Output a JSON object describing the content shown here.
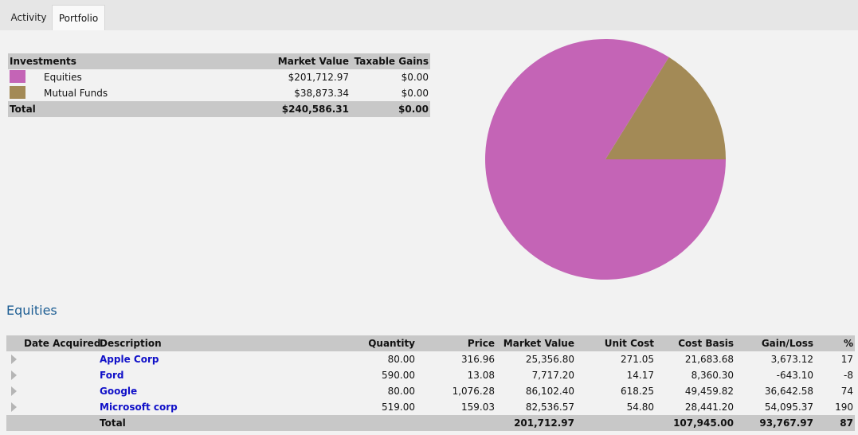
{
  "tabs": [
    {
      "label": "Activity"
    },
    {
      "label": "Portfolio"
    }
  ],
  "summary": {
    "headers": {
      "investments": "Investments",
      "market_value": "Market Value",
      "taxable_gains": "Taxable Gains"
    },
    "rows": [
      {
        "name": "Equities",
        "market_value": "$201,712.97",
        "taxable_gains": "$0.00",
        "color": "#c464b6"
      },
      {
        "name": "Mutual Funds",
        "market_value": "$38,873.34",
        "taxable_gains": "$0.00",
        "color": "#a38a56"
      }
    ],
    "total": {
      "label": "Total",
      "market_value": "$240,586.31",
      "taxable_gains": "$0.00"
    }
  },
  "chart_data": {
    "type": "pie",
    "categories": [
      "Equities",
      "Mutual Funds"
    ],
    "values": [
      201712.97,
      38873.34
    ],
    "colors": [
      "#c464b6",
      "#a38a56"
    ]
  },
  "equities": {
    "title": "Equities",
    "headers": {
      "date": "Date Acquired",
      "description": "Description",
      "quantity": "Quantity",
      "price": "Price",
      "market_value": "Market Value",
      "unit_cost": "Unit Cost",
      "cost_basis": "Cost Basis",
      "gain_loss": "Gain/Loss",
      "pct": "%"
    },
    "rows": [
      {
        "description": "Apple Corp",
        "quantity": "80.00",
        "price": "316.96",
        "market_value": "25,356.80",
        "unit_cost": "271.05",
        "cost_basis": "21,683.68",
        "gain_loss": "3,673.12",
        "pct": "17"
      },
      {
        "description": "Ford",
        "quantity": "590.00",
        "price": "13.08",
        "market_value": "7,717.20",
        "unit_cost": "14.17",
        "cost_basis": "8,360.30",
        "gain_loss": "-643.10",
        "pct": "-8"
      },
      {
        "description": "Google",
        "quantity": "80.00",
        "price": "1,076.28",
        "market_value": "86,102.40",
        "unit_cost": "618.25",
        "cost_basis": "49,459.82",
        "gain_loss": "36,642.58",
        "pct": "74"
      },
      {
        "description": "Microsoft corp",
        "quantity": "519.00",
        "price": "159.03",
        "market_value": "82,536.57",
        "unit_cost": "54.80",
        "cost_basis": "28,441.20",
        "gain_loss": "54,095.37",
        "pct": "190"
      }
    ],
    "total": {
      "label": "Total",
      "market_value": "201,712.97",
      "cost_basis": "107,945.00",
      "gain_loss": "93,767.97",
      "pct": "87"
    }
  }
}
